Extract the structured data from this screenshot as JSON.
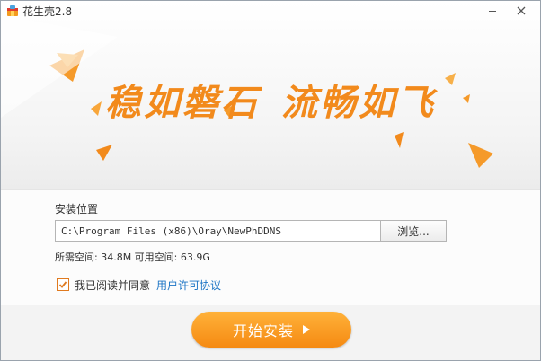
{
  "window": {
    "title": "花生壳2.8",
    "minimize_icon": "minimize-icon",
    "close_icon": "close-icon"
  },
  "banner": {
    "slogan_part1": "稳如磐石",
    "slogan_part2": "流畅如飞"
  },
  "install_location": {
    "label": "安装位置",
    "path_value": "C:\\Program Files (x86)\\Oray\\NewPhDDNS",
    "browse_label": "浏览...",
    "space_info": "所需空间: 34.8M  可用空间: 63.9G"
  },
  "agreement": {
    "checked": true,
    "text": "我已阅读并同意",
    "link_text": "用户许可协议"
  },
  "footer": {
    "install_label": "开始安装"
  },
  "colors": {
    "accent": "#f28a1c",
    "link": "#1a73c4"
  }
}
